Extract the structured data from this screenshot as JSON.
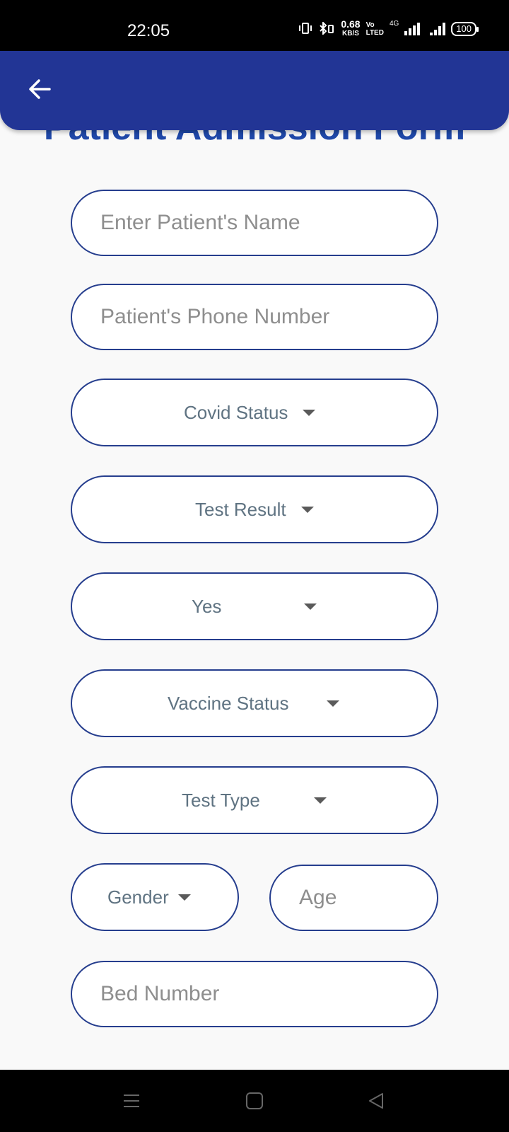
{
  "status_bar": {
    "time": "22:05",
    "net_speed_value": "0.68",
    "net_speed_unit": "KB/S",
    "volte_top": "Vo",
    "volte_bottom": "LTED",
    "network_type": "4G",
    "battery": "100"
  },
  "app_bar": {
    "back_icon": "arrow-left-icon",
    "color": "#223595"
  },
  "page": {
    "title": "Patient Admission Form",
    "title_color": "#1f48a8"
  },
  "form": {
    "name_placeholder": "Enter Patient's Name",
    "phone_placeholder": "Patient's Phone Number",
    "covid_status_label": "Covid Status",
    "test_result_label": "Test Result",
    "yes_no_value": "Yes",
    "vaccine_status_label": "Vaccine Status",
    "test_type_label": "Test Type",
    "gender_label": "Gender",
    "age_placeholder": "Age",
    "bed_number_placeholder": "Bed Number"
  },
  "nav_bar": {
    "menu_icon": "menu-icon",
    "home_icon": "home-square-icon",
    "back_icon": "back-triangle-icon"
  },
  "colors": {
    "border": "#263e8e",
    "dropdown_text": "#5f7382",
    "placeholder_text": "#8e8e8e"
  }
}
